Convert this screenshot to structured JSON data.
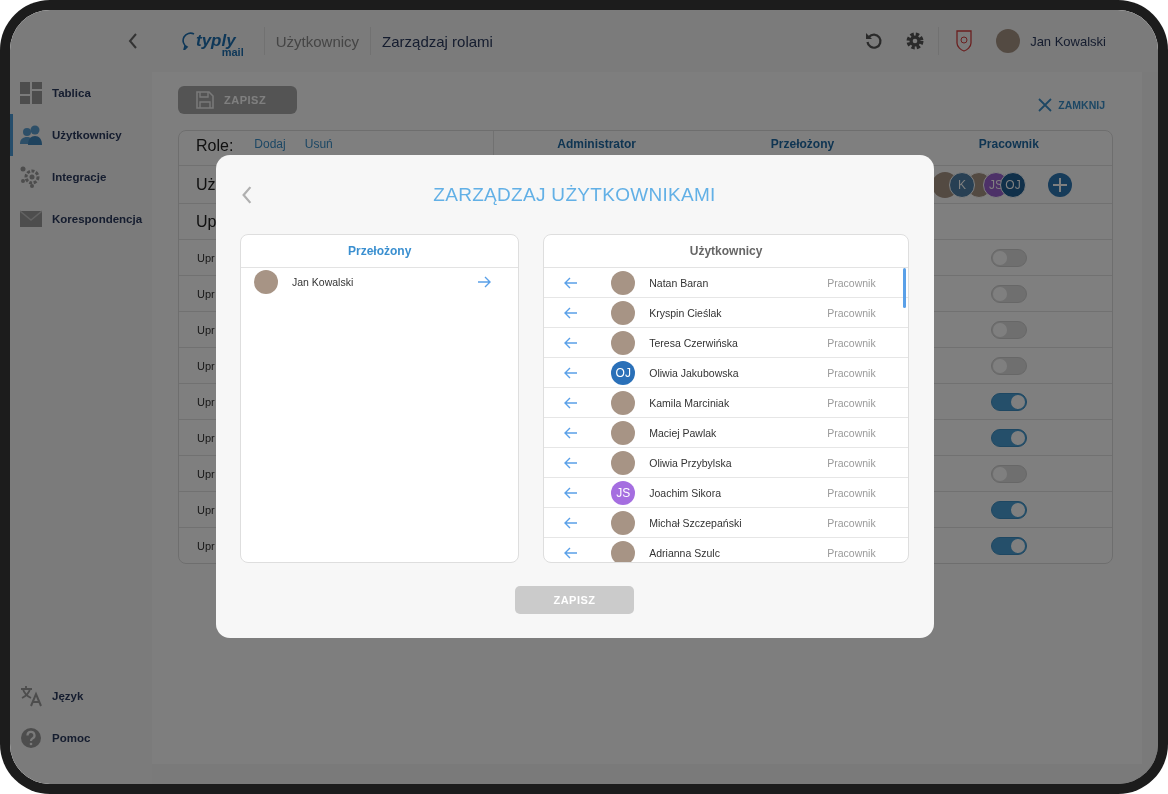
{
  "sidebar": {
    "items": [
      {
        "label": "Tablica",
        "kind": "dashboard",
        "selected": false
      },
      {
        "label": "Użytkownicy",
        "kind": "users",
        "selected": true
      },
      {
        "label": "Integracje",
        "kind": "integrations",
        "selected": false
      },
      {
        "label": "Korespondencja",
        "kind": "mail",
        "selected": false
      }
    ],
    "bottom_items": [
      {
        "label": "Język",
        "kind": "translate"
      },
      {
        "label": "Pomoc",
        "kind": "help"
      }
    ]
  },
  "header": {
    "logo": [
      "typly",
      "mail"
    ],
    "breadcrumbs": [
      {
        "label": "Użytkownicy",
        "current": false
      },
      {
        "label": "Zarządzaj rolami",
        "current": true
      }
    ],
    "user": {
      "name": "Jan Kowalski"
    }
  },
  "toolbar": {
    "save_button": {
      "label": "ZAPISZ",
      "disabled": true
    },
    "close_button": {
      "label": "ZAMKNIJ"
    }
  },
  "roles_table": {
    "label": "Role:",
    "actions": [
      "Dodaj",
      "Usuń"
    ],
    "columns": [
      "Administrator",
      "Przełożony",
      "Pracownik"
    ],
    "rows": [
      {
        "kind": "avatars",
        "label": "Uż",
        "avatars": [
          {
            "kind": "photo"
          },
          {
            "kind": "initials",
            "text": "K",
            "color": "#284054"
          },
          {
            "kind": "photo"
          },
          {
            "kind": "initials",
            "text": "JS",
            "color": "#4d3168"
          },
          {
            "kind": "initials",
            "text": "OJ",
            "color": "#10304a"
          }
        ]
      },
      {
        "kind": "section",
        "label": "Up"
      },
      {
        "kind": "toggle",
        "label": "Upr",
        "on": false
      },
      {
        "kind": "toggle",
        "label": "Upr",
        "on": false
      },
      {
        "kind": "toggle",
        "label": "Upr",
        "on": false
      },
      {
        "kind": "toggle",
        "label": "Upr",
        "on": false
      },
      {
        "kind": "toggle",
        "label": "Upr",
        "on": true
      },
      {
        "kind": "toggle",
        "label": "Upr",
        "on": true
      },
      {
        "kind": "toggle",
        "label": "Upr",
        "on": false
      },
      {
        "kind": "toggle",
        "label": "Upr",
        "on": true
      },
      {
        "kind": "toggle",
        "label": "Upr",
        "on": true
      }
    ]
  },
  "modal": {
    "title": "ZARZĄDZAJ UŻYTKOWNIKAMI",
    "left_panel": {
      "title": "Przełożony",
      "items": [
        {
          "name": "Jan Kowalski",
          "avatar": {
            "kind": "photo"
          }
        }
      ]
    },
    "right_panel": {
      "title": "Użytkownicy",
      "items": [
        {
          "name": "Natan Baran",
          "role": "Pracownik",
          "avatar": {
            "kind": "photo"
          }
        },
        {
          "name": "Kryspin Cieślak",
          "role": "Pracownik",
          "avatar": {
            "kind": "photo"
          }
        },
        {
          "name": "Teresa Czerwińska",
          "role": "Pracownik",
          "avatar": {
            "kind": "photo"
          }
        },
        {
          "name": "Oliwia Jakubowska",
          "role": "Pracownik",
          "avatar": {
            "kind": "initials",
            "text": "OJ",
            "color": "#2a70b8"
          }
        },
        {
          "name": "Kamila Marciniak",
          "role": "Pracownik",
          "avatar": {
            "kind": "photo"
          }
        },
        {
          "name": "Maciej Pawlak",
          "role": "Pracownik",
          "avatar": {
            "kind": "photo"
          }
        },
        {
          "name": "Oliwia Przybylska",
          "role": "Pracownik",
          "avatar": {
            "kind": "photo"
          }
        },
        {
          "name": "Joachim Sikora",
          "role": "Pracownik",
          "avatar": {
            "kind": "initials",
            "text": "JS",
            "color": "#a56ee0"
          }
        },
        {
          "name": "Michał Szczepański",
          "role": "Pracownik",
          "avatar": {
            "kind": "photo"
          }
        },
        {
          "name": "Adrianna Szulc",
          "role": "Pracownik",
          "avatar": {
            "kind": "photo"
          }
        }
      ]
    },
    "save_button": {
      "label": "ZAPISZ",
      "disabled": true
    }
  }
}
